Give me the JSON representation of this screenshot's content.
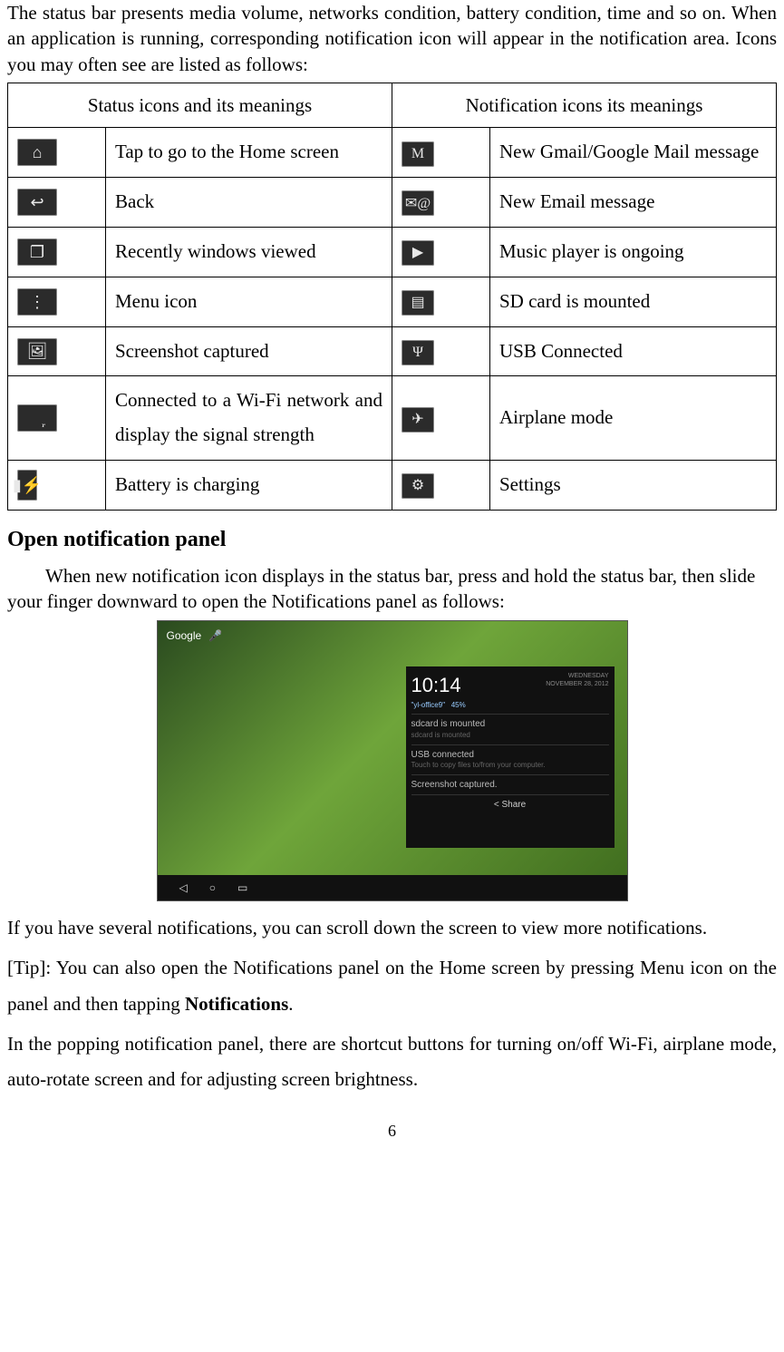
{
  "intro": "The status bar presents media volume, networks condition, battery condition, time and so on. When an application is running, corresponding notification icon will appear in the notification area. Icons you may often see are listed as follows:",
  "table": {
    "header_left": "Status icons and its meanings",
    "header_right": "Notification icons its meanings",
    "rows": [
      {
        "left_icon": "home-icon",
        "left_glyph": "⌂",
        "left_desc": "Tap to go to the Home screen",
        "right_icon": "gmail-icon",
        "right_glyph": "M",
        "right_desc": "New Gmail/Google Mail message"
      },
      {
        "left_icon": "back-icon",
        "left_glyph": "↩",
        "left_desc": "Back",
        "right_icon": "email-icon",
        "right_glyph": "✉@",
        "right_desc": "New Email message"
      },
      {
        "left_icon": "recent-icon",
        "left_glyph": "❐",
        "left_desc": "Recently windows viewed",
        "right_icon": "music-icon",
        "right_glyph": "▶",
        "right_desc": "Music player is ongoing"
      },
      {
        "left_icon": "menu-icon",
        "left_glyph": "⋮",
        "left_desc": "Menu icon",
        "right_icon": "sdcard-icon",
        "right_glyph": "▤",
        "right_desc": "SD card is mounted"
      },
      {
        "left_icon": "screenshot-icon",
        "left_glyph": "🖼",
        "left_desc": "Screenshot captured",
        "right_icon": "usb-icon",
        "right_glyph": "Ψ",
        "right_desc": "USB Connected"
      },
      {
        "left_icon": "wifi-icon",
        "left_glyph": "◉᷊",
        "left_desc": "Connected to a Wi-Fi network and display the signal strength",
        "right_icon": "airplane-icon",
        "right_glyph": "✈",
        "right_desc": "Airplane mode"
      },
      {
        "left_icon": "battery-charging-icon",
        "left_glyph": "▮⚡",
        "left_desc": "Battery is charging",
        "right_icon": "settings-icon",
        "right_glyph": "⚙",
        "right_desc": "Settings"
      }
    ]
  },
  "section_heading": "Open notification panel",
  "para1": "When new notification icon displays in the status bar, press and hold the status bar, then slide your finger downward to open the Notifications panel as follows:",
  "figure": {
    "search_label": "Google",
    "mic_glyph": "🎤",
    "time": "10:14",
    "date": "WEDNESDAY\nNOVEMBER 28, 2012",
    "wifi_name": "\"yl-office9\"",
    "battery": "45%",
    "rows": [
      {
        "title": "sdcard is mounted",
        "sub": "sdcard is mounted"
      },
      {
        "title": "USB connected",
        "sub": "Touch to copy files to/from your computer."
      },
      {
        "title": "Screenshot captured.",
        "sub": ""
      }
    ],
    "share_label": "Share",
    "nav": {
      "back": "◁",
      "home": "○",
      "recent": "▭"
    }
  },
  "para2": "If you have several notifications, you can scroll down the screen to view more notifications.",
  "tip_prefix": "[Tip]: You can also open the Notifications panel on the Home screen by pressing Menu icon on the panel and then tapping ",
  "tip_bold": "Notifications",
  "tip_suffix": ".",
  "para3": "In the popping notification panel, there are shortcut buttons for turning on/off Wi-Fi, airplane mode, auto-rotate screen and for adjusting screen brightness.",
  "page_number": "6"
}
